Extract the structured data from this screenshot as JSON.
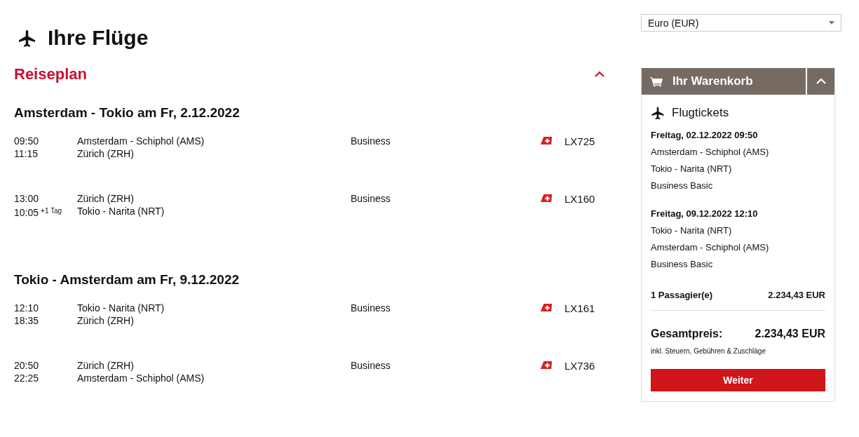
{
  "page_title": "Ihre Flüge",
  "currency_select": {
    "value": "Euro (EUR)"
  },
  "itinerary": {
    "title": "Reiseplan",
    "expanded": true,
    "trips": [
      {
        "heading": "Amsterdam - Tokio am Fr, 2.12.2022",
        "segments": [
          {
            "departure_time": "09:50",
            "arrival_time": "11:15",
            "from": "Amsterdam - Schiphol (AMS)",
            "to": "Zürich (ZRH)",
            "cabin": "Business",
            "flight": "LX725"
          },
          {
            "departure_time": "13:00",
            "arrival_time": "10:05",
            "arrival_day_offset": "+1 Tag",
            "from": "Zürich (ZRH)",
            "to": "Tokio - Narita (NRT)",
            "cabin": "Business",
            "flight": "LX160"
          }
        ]
      },
      {
        "heading": "Tokio - Amsterdam am Fr, 9.12.2022",
        "segments": [
          {
            "departure_time": "12:10",
            "arrival_time": "18:35",
            "from": "Tokio - Narita (NRT)",
            "to": "Zürich (ZRH)",
            "cabin": "Business",
            "flight": "LX161"
          },
          {
            "departure_time": "20:50",
            "arrival_time": "22:25",
            "from": "Zürich (ZRH)",
            "to": "Amsterdam - Schiphol (AMS)",
            "cabin": "Business",
            "flight": "LX736"
          }
        ]
      }
    ]
  },
  "cart": {
    "title": "Ihr Warenkorb",
    "expanded": true,
    "section_title": "Flugtickets",
    "flights": [
      {
        "date": "Freitag, 02.12.2022 09:50",
        "from": "Amsterdam - Schiphol (AMS)",
        "to": "Tokio - Narita (NRT)",
        "fare": "Business Basic"
      },
      {
        "date": "Freitag, 09.12.2022 12:10",
        "from": "Tokio - Narita (NRT)",
        "to": "Amsterdam - Schiphol (AMS)",
        "fare": "Business Basic"
      }
    ],
    "passengers": {
      "label": "1 Passagier(e)",
      "price": "2.234,43 EUR"
    },
    "total": {
      "label": "Gesamtpreis:",
      "price": "2.234,43 EUR"
    },
    "note": "inkl. Steuern, Gebühren & Zuschläge",
    "button": "Weiter"
  }
}
